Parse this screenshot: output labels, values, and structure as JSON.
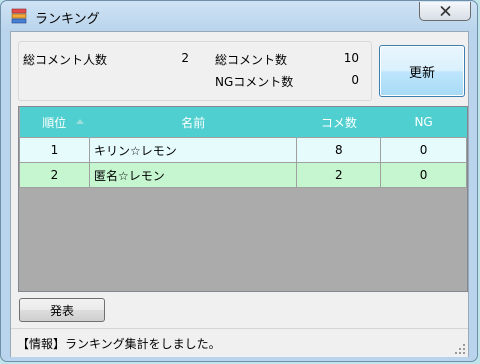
{
  "window": {
    "title": "ランキング",
    "icon": "app-books-icon",
    "close_icon": "close-icon"
  },
  "summary": {
    "total_users_label": "総コメント人数",
    "total_users_value": "2",
    "total_comments_label": "総コメント数",
    "total_comments_value": "10",
    "ng_comments_label": "NGコメント数",
    "ng_comments_value": "0"
  },
  "buttons": {
    "update": "更新",
    "present": "発表"
  },
  "table": {
    "headers": {
      "rank": "順位",
      "name": "名前",
      "count": "コメ数",
      "ng": "NG"
    },
    "sort_icon": "sort-ascending-icon",
    "rows": [
      {
        "rank": "1",
        "name": "キリン☆レモン",
        "count": "8",
        "ng": "0"
      },
      {
        "rank": "2",
        "name": "匿名☆レモン",
        "count": "2",
        "ng": "0"
      }
    ]
  },
  "status": {
    "message": "【情報】ランキング集計をしました。"
  },
  "colors": {
    "header_bg": "#4fcfcf",
    "row_odd_bg": "#e6fbfb",
    "row_even_bg": "#c6f6d0",
    "grid_bg": "#ababab"
  }
}
